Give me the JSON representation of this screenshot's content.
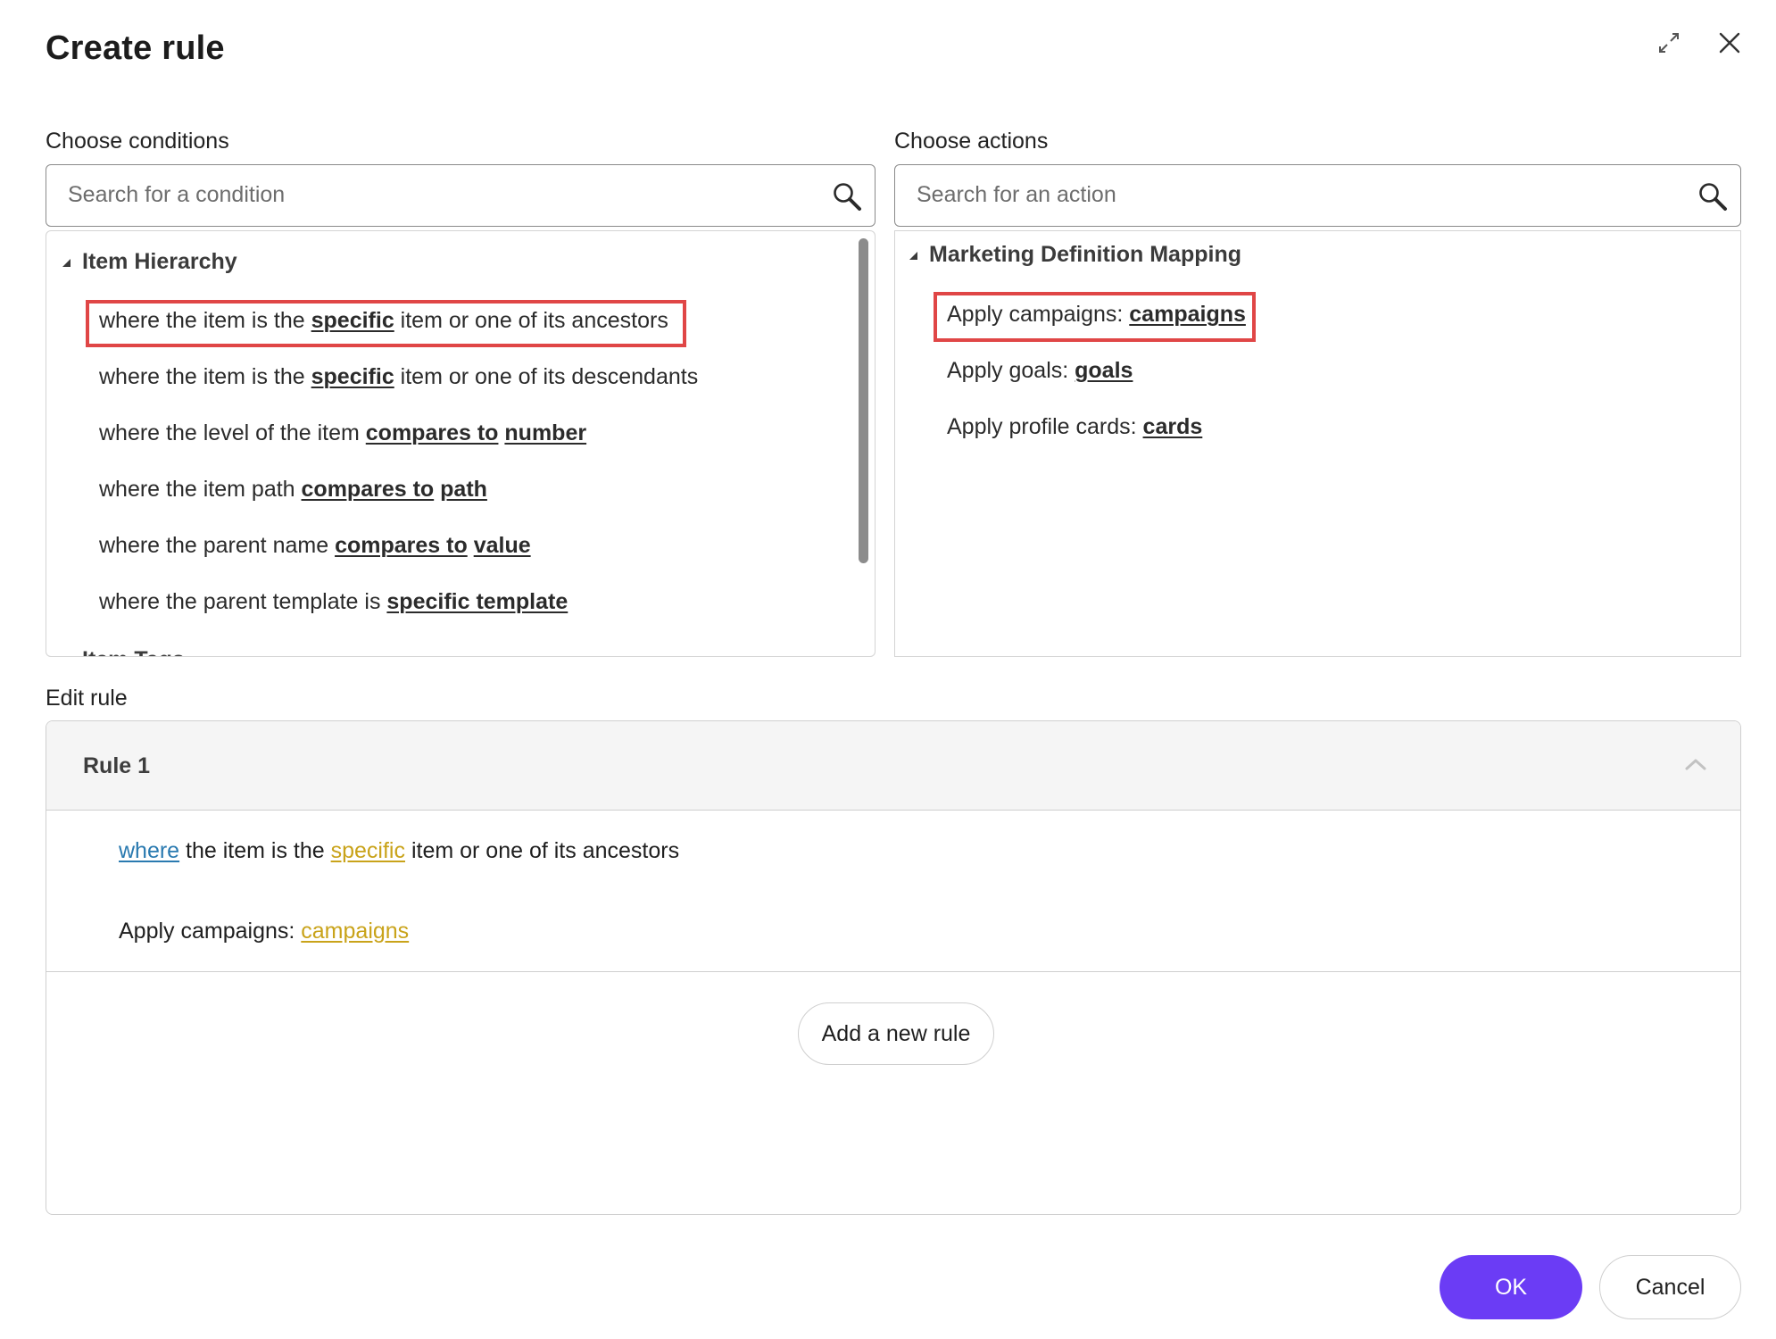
{
  "dialog": {
    "title": "Create rule"
  },
  "conditions": {
    "label": "Choose conditions",
    "search_placeholder": "Search for a condition",
    "groups": [
      {
        "name": "Item Hierarchy",
        "items": [
          {
            "pre": "where the item is the ",
            "kw1": "specific",
            "mid": " item or one of its ancestors",
            "kw2": ""
          },
          {
            "pre": "where the item is the ",
            "kw1": "specific",
            "mid": " item or one of its descendants",
            "kw2": ""
          },
          {
            "pre": "where the level of the item ",
            "kw1": "compares to",
            "mid": " ",
            "kw2": "number"
          },
          {
            "pre": "where the item path ",
            "kw1": "compares to",
            "mid": " ",
            "kw2": "path"
          },
          {
            "pre": "where the parent name ",
            "kw1": "compares to",
            "mid": " ",
            "kw2": "value"
          },
          {
            "pre": "where the parent template is ",
            "kw1": "specific template",
            "mid": "",
            "kw2": ""
          }
        ]
      },
      {
        "name": "Item Tags"
      }
    ]
  },
  "actions": {
    "label": "Choose actions",
    "search_placeholder": "Search for an action",
    "groups": [
      {
        "name": "Marketing Definition Mapping",
        "items": [
          {
            "pre": "Apply campaigns: ",
            "kw": "campaigns"
          },
          {
            "pre": "Apply goals: ",
            "kw": "goals"
          },
          {
            "pre": "Apply profile cards: ",
            "kw": "cards"
          }
        ]
      }
    ]
  },
  "edit_rule": {
    "label": "Edit rule",
    "rule_title": "Rule 1",
    "condition": {
      "link1": "where",
      "text1": " the item is the ",
      "link2": "specific",
      "text2": " item or one of its ancestors"
    },
    "action": {
      "text": "Apply campaigns: ",
      "link": "campaigns"
    },
    "add_rule_label": "Add a new rule"
  },
  "footer": {
    "ok_label": "OK",
    "cancel_label": "Cancel"
  },
  "colors": {
    "primary": "#6b3cf5",
    "highlight_border": "#e04646",
    "link_blue": "#2a7ab0",
    "link_gold": "#c9a31a"
  },
  "icons": [
    "expand-icon",
    "close-icon",
    "search-icon",
    "chevron-up-icon",
    "collapse-triangle-icon"
  ]
}
